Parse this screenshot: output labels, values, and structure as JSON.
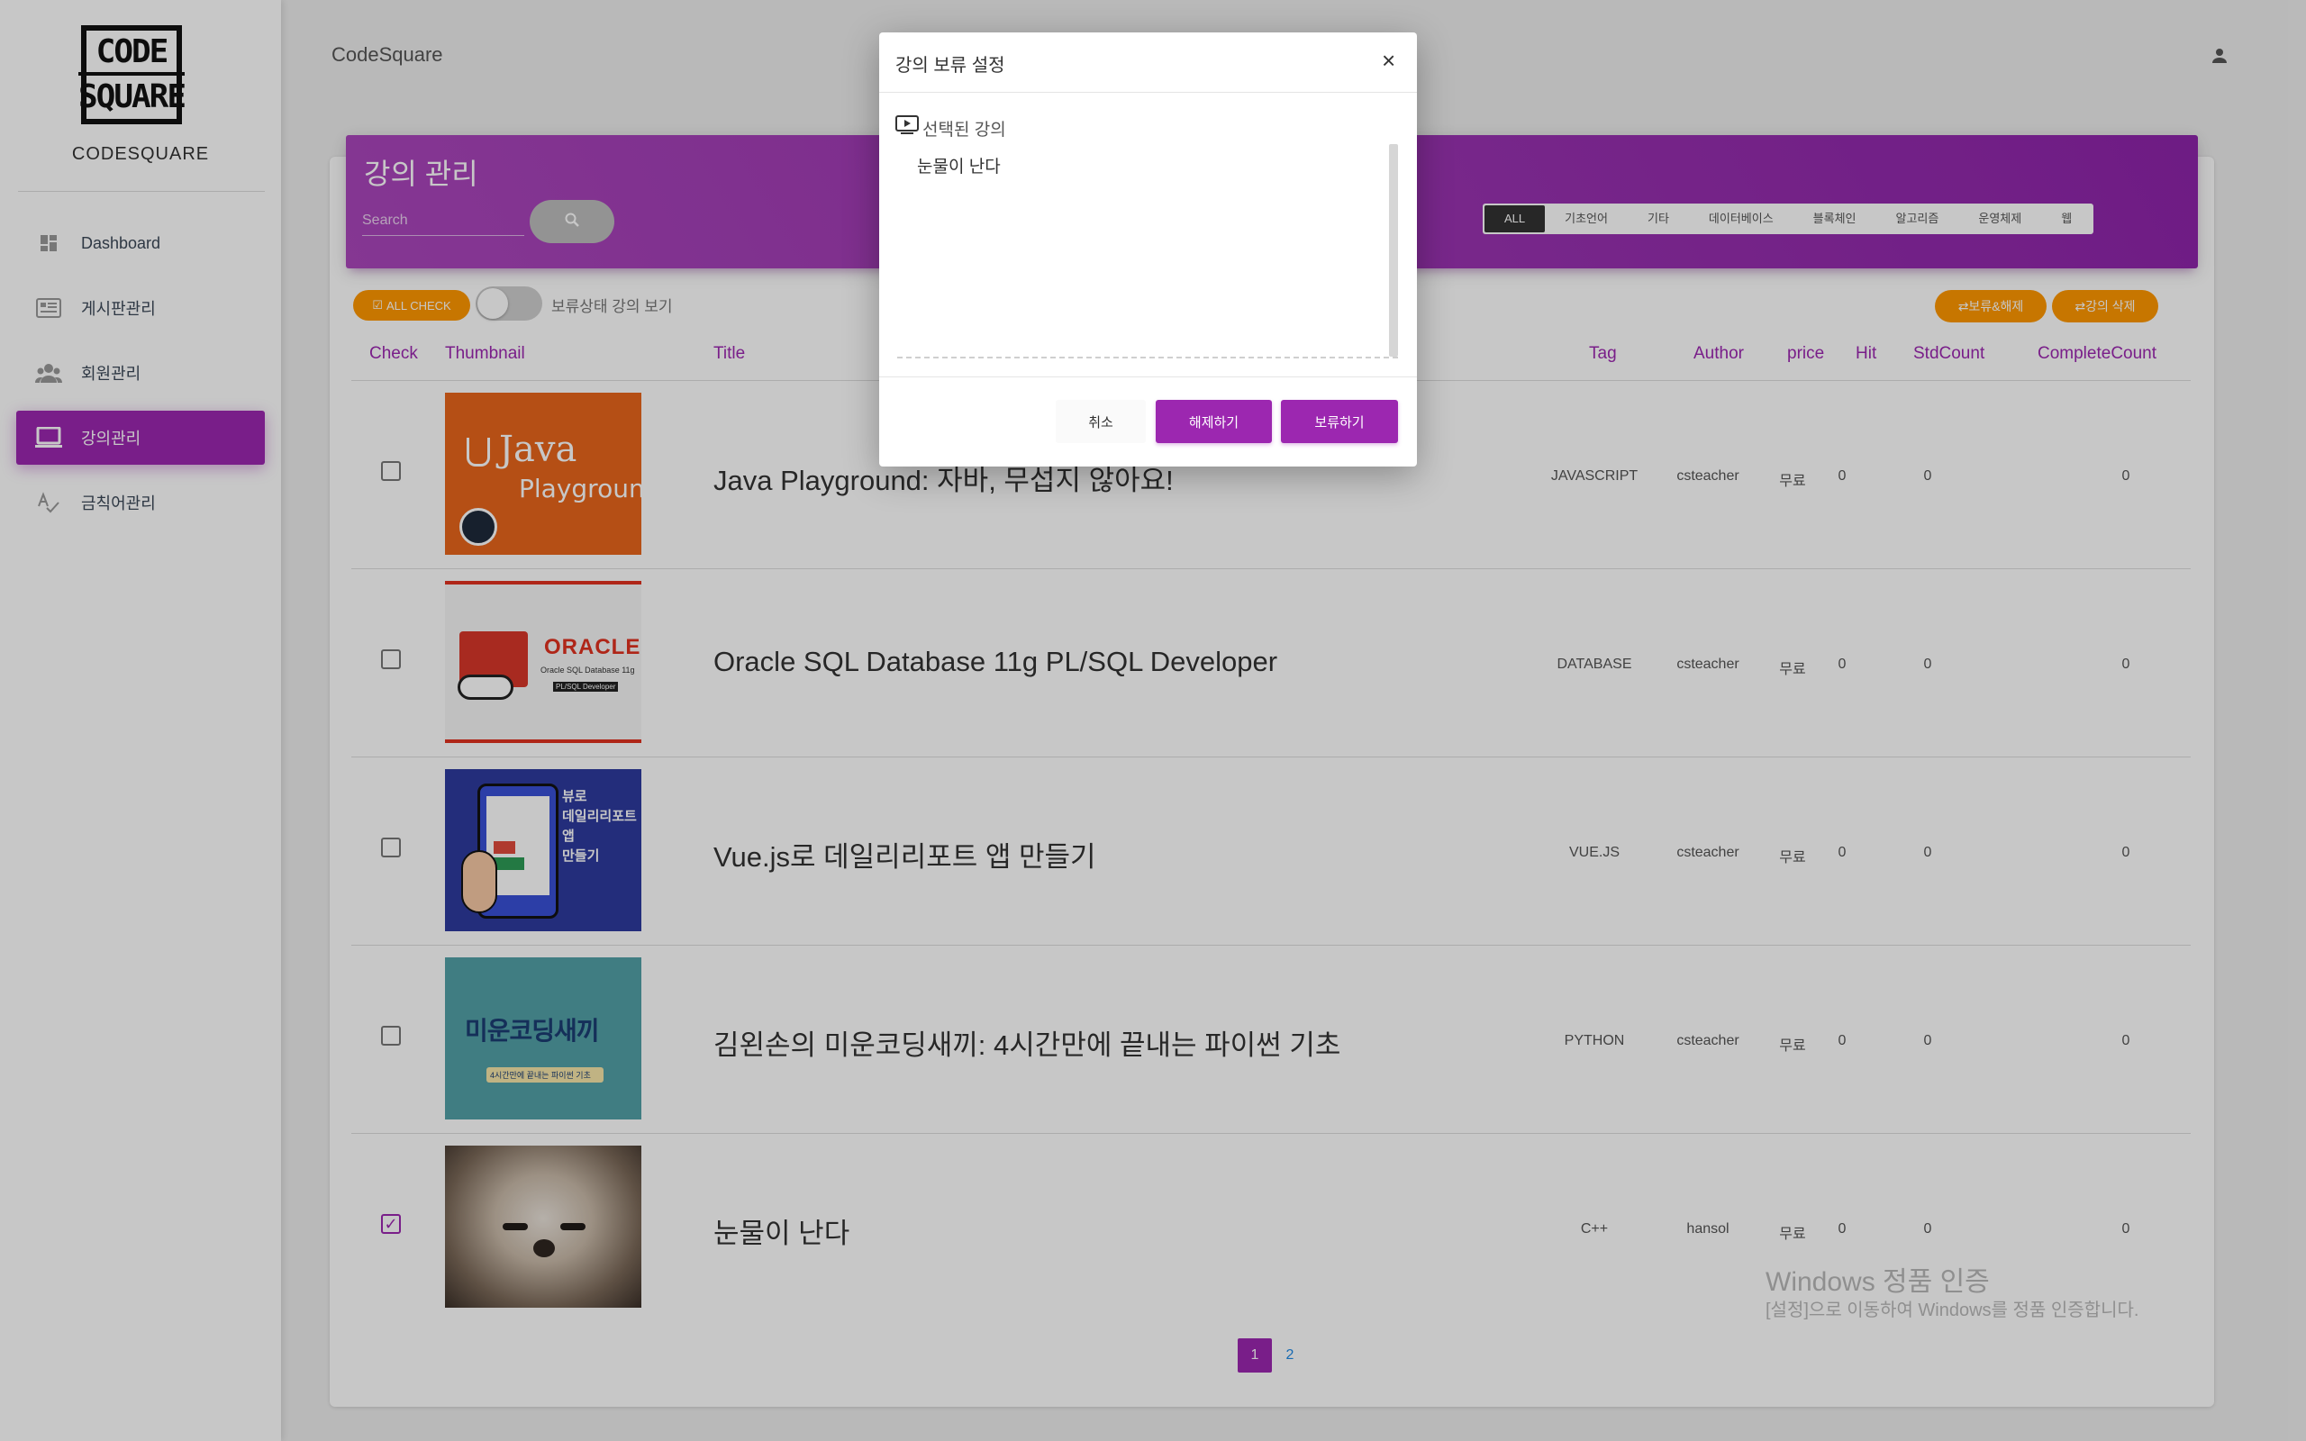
{
  "sidebar": {
    "logo_lines": [
      "CODE",
      "SQUARE"
    ],
    "brand": "CODESQUARE",
    "items": [
      {
        "label": "Dashboard",
        "icon": "dashboard-icon"
      },
      {
        "label": "게시판관리",
        "icon": "board-icon"
      },
      {
        "label": "회원관리",
        "icon": "members-icon"
      },
      {
        "label": "강의관리",
        "icon": "laptop-icon",
        "active": true
      },
      {
        "label": "금칙어관리",
        "icon": "spellcheck-icon"
      }
    ]
  },
  "header": {
    "title": "CodeSquare",
    "user_icon": "person-icon"
  },
  "card": {
    "title": "강의 관리",
    "search_placeholder": "Search",
    "tags": [
      "ALL",
      "기초언어",
      "기타",
      "데이터베이스",
      "블록체인",
      "알고리즘",
      "운영체제",
      "웹"
    ],
    "active_tag": "ALL",
    "all_check_label": "ALL CHECK",
    "toggle_label": "보류상태 강의 보기",
    "hold_button": "⇄보류&해제",
    "delete_button": "⇄강의 삭제"
  },
  "table": {
    "headers": [
      "Check",
      "Thumbnail",
      "Title",
      "Tag",
      "Author",
      "price",
      "Hit",
      "StdCount",
      "CompleteCount"
    ],
    "rows": [
      {
        "title": "Java Playground: 자바, 무섭지 않아요!",
        "tag": "JAVASCRIPT",
        "author": "csteacher",
        "price": "무료",
        "hit": "0",
        "std": "0",
        "complete": "0",
        "checked": false
      },
      {
        "title": "Oracle SQL Database 11g PL/SQL Developer",
        "tag": "DATABASE",
        "author": "csteacher",
        "price": "무료",
        "hit": "0",
        "std": "0",
        "complete": "0",
        "checked": false
      },
      {
        "title": "Vue.js로 데일리리포트 앱 만들기",
        "tag": "VUE.JS",
        "author": "csteacher",
        "price": "무료",
        "hit": "0",
        "std": "0",
        "complete": "0",
        "checked": false
      },
      {
        "title": "김왼손의 미운코딩새끼: 4시간만에 끝내는 파이썬 기초",
        "tag": "PYTHON",
        "author": "csteacher",
        "price": "무료",
        "hit": "0",
        "std": "0",
        "complete": "0",
        "checked": false
      },
      {
        "title": "눈물이 난다",
        "tag": "C++",
        "author": "hansol",
        "price": "무료",
        "hit": "0",
        "std": "0",
        "complete": "0",
        "checked": true
      }
    ],
    "thumbnails": {
      "java": {
        "line1": "Java",
        "line2": "Playground"
      },
      "oracle": {
        "brand": "ORACLE",
        "sub1": "Oracle SQL Database 11g",
        "sub2": "PL/SQL Developer"
      },
      "vue": {
        "text": "뷰로\n데일리리포트 앱\n만들기"
      },
      "python": {
        "main": "미운코딩새끼",
        "sub": "4시간만에 끝내는 파이썬 기초"
      }
    }
  },
  "pagination": {
    "pages": [
      "1",
      "2"
    ],
    "current": "1"
  },
  "watermark": {
    "line1": "Windows 정품 인증",
    "line2": "[설정]으로 이동하여 Windows를 정품 인증합니다."
  },
  "modal": {
    "title": "강의 보류 설정",
    "close": "×",
    "subtitle": "선택된 강의",
    "selected_items": [
      "눈물이 난다"
    ],
    "cancel": "취소",
    "release": "해제하기",
    "hold": "보류하기"
  },
  "colors": {
    "primary": "#9c27b0",
    "warning": "#ff9800",
    "link": "#1e88e5"
  }
}
